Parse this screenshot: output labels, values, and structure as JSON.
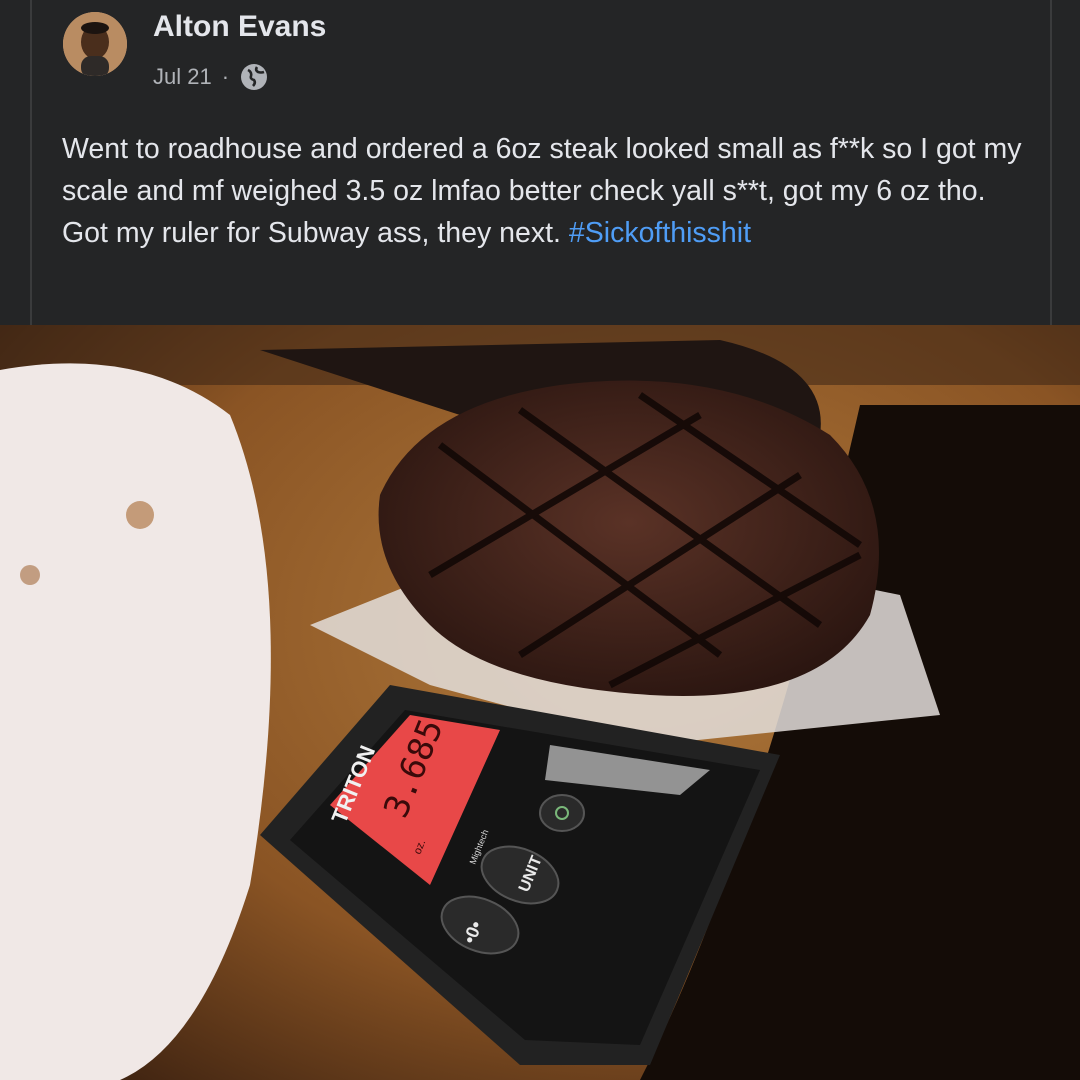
{
  "post": {
    "author": "Alton Evans",
    "date": "Jul 21",
    "separator": "·",
    "privacy_icon": "globe-icon",
    "text": "Went to roadhouse and ordered a 6oz steak looked small as f**k so I got my scale and mf weighed 3.5 oz lmfao better check yall s**t, got my 6 oz tho. Got my ruler for Subway ass, they next. ",
    "hashtag": "#Sickofthisshit",
    "hashtag_color": "#4f9df6"
  },
  "photo": {
    "scale_brand": "TRITON",
    "scale_reading": "3.685",
    "scale_unit": "oz.",
    "scale_logo": "Mightech",
    "scale_tare_label": "•0•",
    "scale_unit_button": "UNIT"
  }
}
